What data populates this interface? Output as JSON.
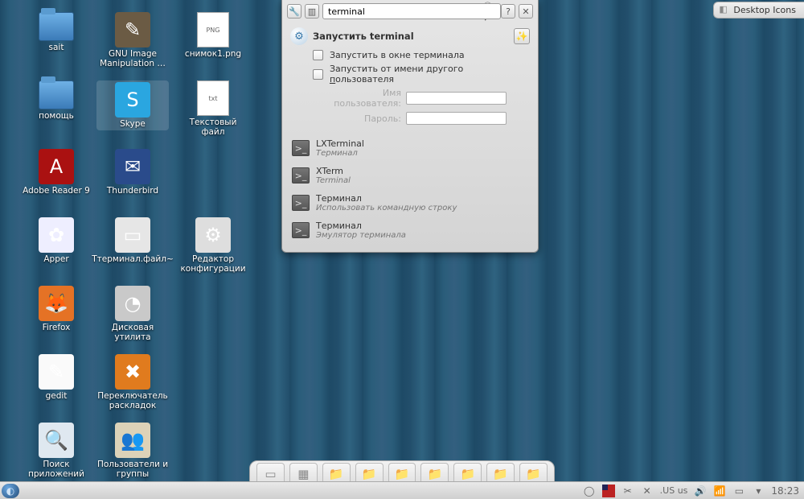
{
  "cornerBadge": "Desktop Icons",
  "desktopIcons": [
    {
      "key": "sait",
      "label": "sait",
      "col": 0,
      "row": 0,
      "kind": "folder"
    },
    {
      "key": "help",
      "label": "помощь",
      "col": 0,
      "row": 1,
      "kind": "folder"
    },
    {
      "key": "adobe",
      "label": "Adobe Reader 9",
      "col": 0,
      "row": 2,
      "kind": "app",
      "bg": "#a11",
      "glyph": "A"
    },
    {
      "key": "apper",
      "label": "Apper",
      "col": 0,
      "row": 3,
      "kind": "app",
      "bg": "#eef",
      "glyph": "✿"
    },
    {
      "key": "firefox",
      "label": "Firefox",
      "col": 0,
      "row": 4,
      "kind": "app",
      "bg": "#e57225",
      "glyph": "🦊"
    },
    {
      "key": "gedit",
      "label": "gedit",
      "col": 0,
      "row": 5,
      "kind": "app",
      "bg": "#fafafa",
      "glyph": "✎"
    },
    {
      "key": "searchapps",
      "label": "Поиск приложений",
      "col": 0,
      "row": 6,
      "kind": "app",
      "bg": "#dfe8f0",
      "glyph": "🔍"
    },
    {
      "key": "gimp",
      "label": "GNU Image Manipulation …",
      "col": 1,
      "row": 0,
      "kind": "app",
      "bg": "#6b5b44",
      "glyph": "✎"
    },
    {
      "key": "skype",
      "label": "Skype",
      "col": 1,
      "row": 1,
      "kind": "app",
      "bg": "#2aa6e0",
      "glyph": "S",
      "selected": true
    },
    {
      "key": "tbird",
      "label": "Thunderbird",
      "col": 1,
      "row": 2,
      "kind": "app",
      "bg": "#2a4b8b",
      "glyph": "✉"
    },
    {
      "key": "termfile",
      "label": "Tтерминал.файл~",
      "col": 1,
      "row": 3,
      "kind": "app",
      "bg": "#e6e6e6",
      "glyph": "▭"
    },
    {
      "key": "diskutil",
      "label": "Дисковая утилита",
      "col": 1,
      "row": 4,
      "kind": "app",
      "bg": "#c9c9c9",
      "glyph": "◔"
    },
    {
      "key": "xneur",
      "label": "Переключатель раскладок",
      "col": 1,
      "row": 5,
      "kind": "app",
      "bg": "#e07b1e",
      "glyph": "✖"
    },
    {
      "key": "usersgroups",
      "label": "Пользователи и группы",
      "col": 1,
      "row": 6,
      "kind": "app",
      "bg": "#dcd2b8",
      "glyph": "👥"
    },
    {
      "key": "shot",
      "label": "снимок1.png",
      "col": 2,
      "row": 0,
      "kind": "sheet",
      "text": "PNG"
    },
    {
      "key": "txt",
      "label": "Текстовый файл",
      "col": 2,
      "row": 1,
      "kind": "sheet",
      "text": "txt"
    },
    {
      "key": "confedit",
      "label": "Редактор конфигурации",
      "col": 2,
      "row": 3,
      "kind": "app",
      "bg": "#dedede",
      "glyph": "⚙"
    }
  ],
  "runner": {
    "search": "terminal",
    "header": "Запустить terminal",
    "opt_run_in_terminal": "Запустить в окне терминала",
    "opt_run_as_user": "Запустить от имени другого пользователя",
    "username_label": "Имя пользователя:",
    "password_label": "Пароль:",
    "results": [
      {
        "title": "LXTerminal",
        "sub": "Терминал"
      },
      {
        "title": "XTerm",
        "sub": "Terminal"
      },
      {
        "title": "Терминал",
        "sub": "Использовать командную строку"
      },
      {
        "title": "Терминал",
        "sub": "Эмулятор терминала"
      }
    ]
  },
  "dockItems": [
    "▭",
    "▦",
    "📁",
    "📁",
    "📁",
    "📁",
    "📁",
    "📁",
    "📁"
  ],
  "tray": {
    "layout": "US",
    "layoutLower": "us",
    "time": "18:23"
  }
}
